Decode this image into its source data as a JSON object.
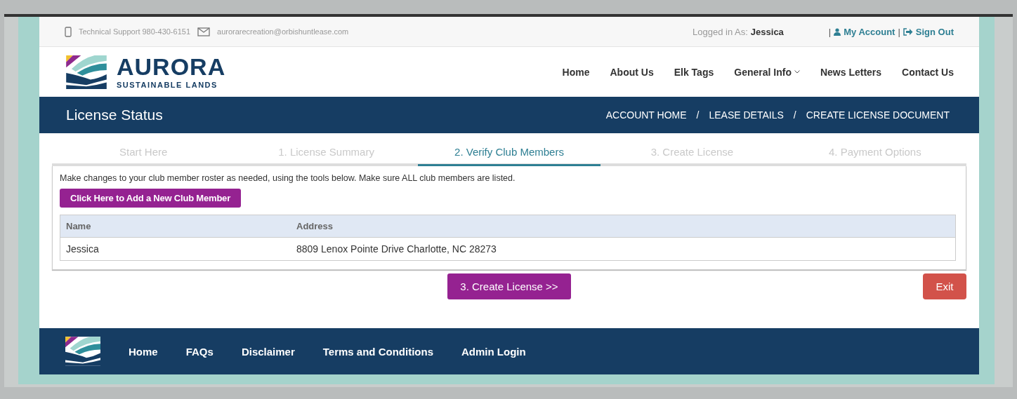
{
  "top_bar": {
    "support": "Technical Support 980-430-6151",
    "email": "aurorarecreation@orbishuntlease.com",
    "logged_in_label": "Logged in As:",
    "user": "Jessica",
    "separator": "|",
    "my_account": "My Account",
    "sign_out": "Sign Out"
  },
  "logo": {
    "name": "AURORA",
    "tagline": "SUSTAINABLE LANDS"
  },
  "nav": [
    {
      "label": "Home",
      "dropdown": false
    },
    {
      "label": "About Us",
      "dropdown": false
    },
    {
      "label": "Elk Tags",
      "dropdown": false
    },
    {
      "label": "General Info",
      "dropdown": true
    },
    {
      "label": "News Letters",
      "dropdown": false
    },
    {
      "label": "Contact Us",
      "dropdown": false
    }
  ],
  "title_bar": {
    "title": "License Status",
    "separator": "/",
    "breadcrumbs": [
      "ACCOUNT HOME",
      "LEASE DETAILS",
      "CREATE LICENSE DOCUMENT"
    ]
  },
  "steps": [
    {
      "label": "Start Here",
      "selected": false
    },
    {
      "label": "1. License Summary",
      "selected": false
    },
    {
      "label": "2. Verify Club Members",
      "selected": true
    },
    {
      "label": "3. Create License",
      "selected": false
    },
    {
      "label": "4. Payment Options",
      "selected": false
    }
  ],
  "instructions": "Make changes to your club member roster as needed, using the tools below. Make sure ALL club members are listed.",
  "add_button": "Click Here to Add a New Club Member",
  "table": {
    "columns": [
      "Name",
      "Address"
    ],
    "rows": [
      [
        "Jessica",
        "8809 Lenox Pointe Drive Charlotte, NC 28273"
      ]
    ]
  },
  "next_button": "3. Create License >>",
  "exit_button": "Exit",
  "footer": {
    "links": [
      "Home",
      "FAQs",
      "Disclaimer",
      "Terms and Conditions",
      "Admin Login"
    ]
  }
}
